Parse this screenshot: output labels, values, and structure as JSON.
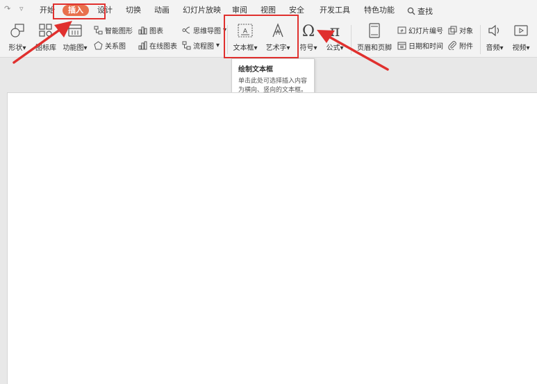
{
  "menubar": {
    "tabs": [
      {
        "label": "开始"
      },
      {
        "label": "插入"
      },
      {
        "label": "设计"
      },
      {
        "label": "切换"
      },
      {
        "label": "动画"
      },
      {
        "label": "幻灯片放映"
      },
      {
        "label": "审阅"
      },
      {
        "label": "视图"
      },
      {
        "label": "安全"
      },
      {
        "label": "开发工具"
      },
      {
        "label": "特色功能"
      }
    ],
    "search_label": "查找",
    "active_tab": "插入"
  },
  "ribbon": {
    "shape": "形状",
    "gallery": "图标库",
    "function_chart": "功能图",
    "smart_art": "智能图形",
    "chart": "图表",
    "relation": "关系图",
    "online_chart": "在线图表",
    "mind_map": "思维导图",
    "flowchart": "流程图",
    "textbox": "文本框",
    "wordart": "艺术字",
    "symbol": "符号",
    "formula": "公式",
    "header_footer": "页眉和页脚",
    "slide_number": "幻灯片编号",
    "object": "对象",
    "datetime": "日期和时间",
    "attachment": "附件",
    "audio": "音频",
    "video": "视频"
  },
  "tooltip": {
    "title": "绘制文本框",
    "description": "单击此处可选择插入内容为横向、竖向的文本框。"
  },
  "colors": {
    "accent": "#e8704c",
    "highlight": "#e0302e"
  }
}
